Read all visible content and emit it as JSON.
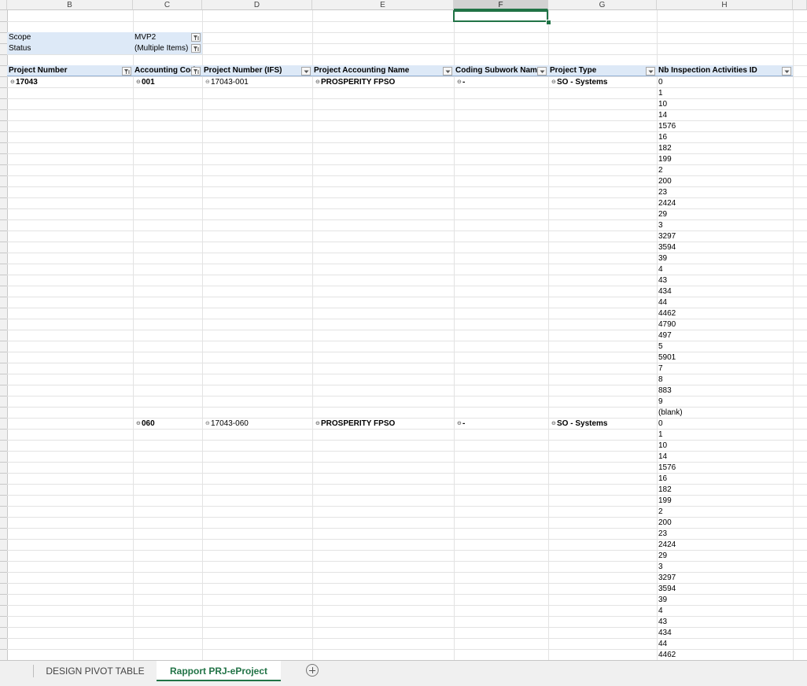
{
  "columns": [
    "B",
    "C",
    "D",
    "E",
    "F",
    "G",
    "H"
  ],
  "selected_column": "F",
  "filters": {
    "scope_label": "Scope",
    "scope_value": "MVP2",
    "status_label": "Status",
    "status_value": "(Multiple Items)"
  },
  "headers": {
    "project_number": "Project Number",
    "accounting": "Accounting Code",
    "project_number_ifs": "Project Number (IFS)",
    "accounting_name": "Project Accounting Name",
    "coding_subwork": "Coding Subwork Name",
    "project_type": "Project Type",
    "nb_inspection": "Nb Inspection Activities ID"
  },
  "project": "17043",
  "groups": [
    {
      "accounting": "001",
      "ifs": "17043-001",
      "name": "PROSPERITY FPSO",
      "subwork": "-",
      "type": "SO - Systems",
      "ids": [
        "0",
        "1",
        "10",
        "14",
        "1576",
        "16",
        "182",
        "199",
        "2",
        "200",
        "23",
        "2424",
        "29",
        "3",
        "3297",
        "3594",
        "39",
        "4",
        "43",
        "434",
        "44",
        "4462",
        "4790",
        "497",
        "5",
        "5901",
        "7",
        "8",
        "883",
        "9",
        "(blank)"
      ]
    },
    {
      "accounting": "060",
      "ifs": "17043-060",
      "name": "PROSPERITY FPSO",
      "subwork": "-",
      "type": "SO - Systems",
      "ids": [
        "0",
        "1",
        "10",
        "14",
        "1576",
        "16",
        "182",
        "199",
        "2",
        "200",
        "23",
        "2424",
        "29",
        "3",
        "3297",
        "3594",
        "39",
        "4",
        "43",
        "434",
        "44",
        "4462"
      ]
    }
  ],
  "tabs": {
    "design": "DESIGN PIVOT TABLE",
    "rapport": "Rapport  PRJ-eProject"
  },
  "colors": {
    "accent": "#217346",
    "pivot_fill": "#dde9f7"
  }
}
